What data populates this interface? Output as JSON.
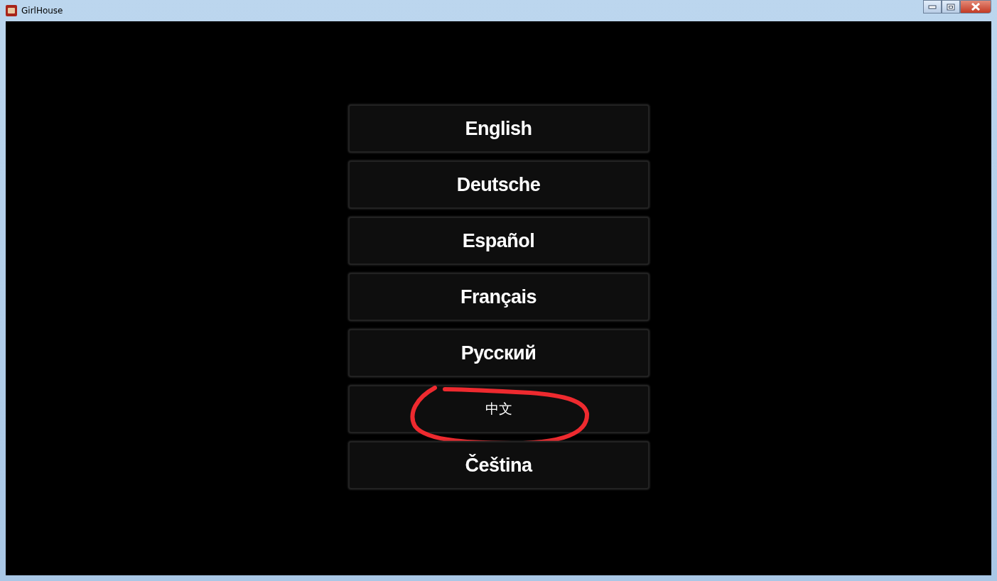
{
  "window": {
    "title": "GirlHouse"
  },
  "languages": [
    {
      "label": "English",
      "kind": "bold",
      "circled": false
    },
    {
      "label": "Deutsche",
      "kind": "bold",
      "circled": false
    },
    {
      "label": "Español",
      "kind": "bold",
      "circled": false
    },
    {
      "label": "Français",
      "kind": "bold",
      "circled": false
    },
    {
      "label": "Русский",
      "kind": "bold",
      "circled": false
    },
    {
      "label": "中文",
      "kind": "plain",
      "circled": true
    },
    {
      "label": "Čeština",
      "kind": "bold",
      "circled": false
    }
  ]
}
